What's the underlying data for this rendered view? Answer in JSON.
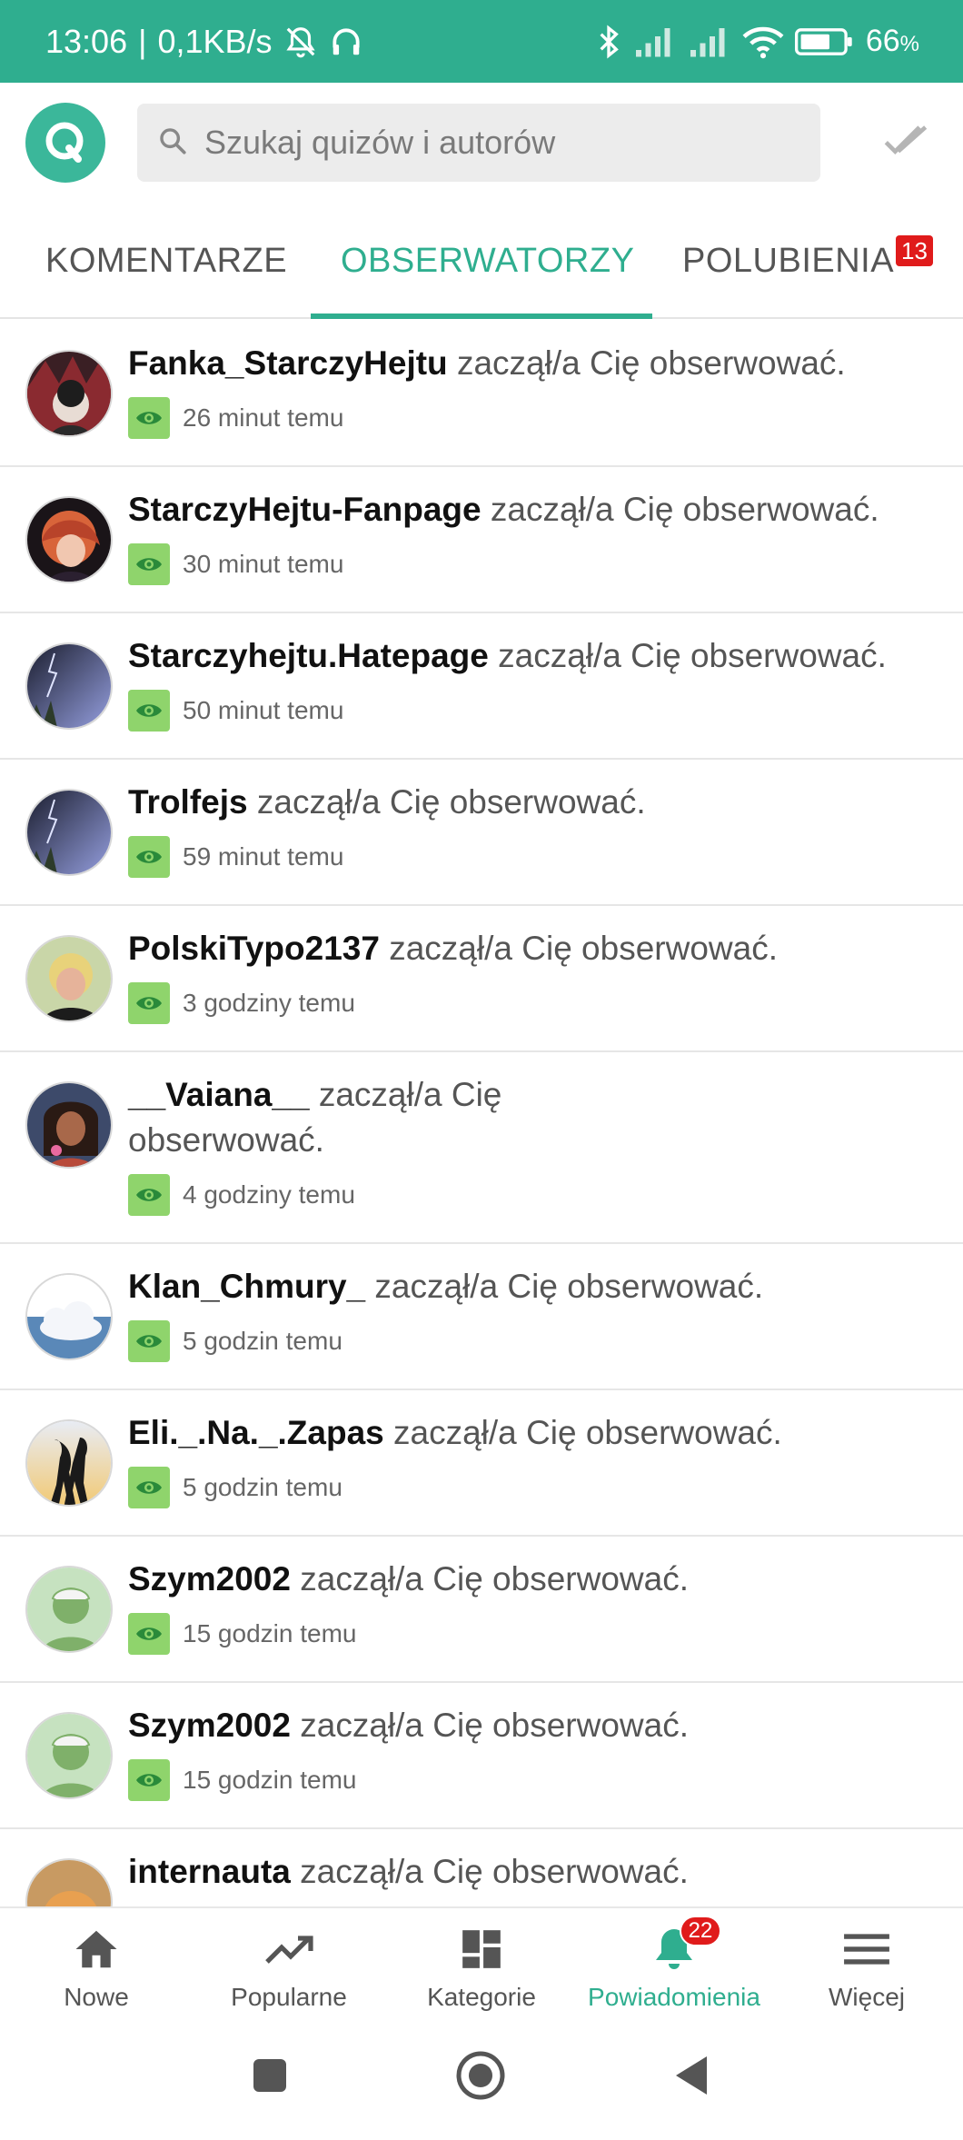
{
  "status_bar": {
    "time": "13:06",
    "separator": "|",
    "net_speed": "0,1KB/s",
    "battery_percent": "66",
    "battery_unit": "%"
  },
  "search": {
    "placeholder": "Szukaj quizów i autorów"
  },
  "logo": {
    "letter": "Q"
  },
  "tabs": [
    {
      "label": "KOMENTARZE"
    },
    {
      "label": "OBSERWATORZY"
    },
    {
      "label": "POLUBIENIA",
      "badge": "13"
    }
  ],
  "notifications": [
    {
      "user": "Fanka_StarczyHejtu",
      "action": "zaczął/a Cię obserwować.",
      "time": "26 minut temu",
      "avatar": "avatar-dark-girl"
    },
    {
      "user": "StarczyHejtu-Fanpage",
      "action": "zaczął/a Cię obserwować.",
      "time": "30 minut temu",
      "avatar": "avatar-redhead"
    },
    {
      "user": "Starczyhejtu.Hatepage",
      "action": "zaczął/a Cię obserwować.",
      "time": "50 minut temu",
      "avatar": "avatar-lightning"
    },
    {
      "user": "Trolfejs",
      "action": "zaczął/a Cię obserwować.",
      "time": "59 minut temu",
      "avatar": "avatar-lightning"
    },
    {
      "user": "PolskiTypo2137",
      "action": "zaczął/a Cię obserwować.",
      "time": "3 godziny temu",
      "avatar": "avatar-blonde"
    },
    {
      "user": "__Vaiana__",
      "action": "zaczął/a Cię",
      "action_2": "obserwować.",
      "time": "4 godziny temu",
      "avatar": "avatar-vaiana"
    },
    {
      "user": "Klan_Chmury_",
      "action": "zaczął/a Cię obserwować.",
      "time": "5 godzin temu",
      "avatar": "avatar-cloud"
    },
    {
      "user": "Eli._.Na._.Zapas",
      "action": "zaczął/a Cię obserwować.",
      "time": "5 godzin temu",
      "avatar": "avatar-silhouettes"
    },
    {
      "user": "Szym2002",
      "action": "zaczął/a Cię obserwować.",
      "time": "15 godzin temu",
      "avatar": "avatar-default"
    },
    {
      "user": "Szym2002",
      "action": "zaczął/a Cię obserwować.",
      "time": "15 godzin temu",
      "avatar": "avatar-default"
    },
    {
      "user": "internauta",
      "action": "zaczął/a Cię obserwować.",
      "time": "",
      "avatar": "avatar-cat"
    }
  ],
  "bottom_nav": [
    {
      "label": "Nowe",
      "icon": "home-icon"
    },
    {
      "label": "Popularne",
      "icon": "trending-icon"
    },
    {
      "label": "Kategorie",
      "icon": "grid-icon"
    },
    {
      "label": "Powiadomienia",
      "icon": "bell-icon",
      "badge": "22"
    },
    {
      "label": "Więcej",
      "icon": "menu-icon"
    }
  ],
  "colors": {
    "accent": "#2fae8f",
    "badge": "#e01b1b",
    "eye_badge": "#8fd46c"
  }
}
